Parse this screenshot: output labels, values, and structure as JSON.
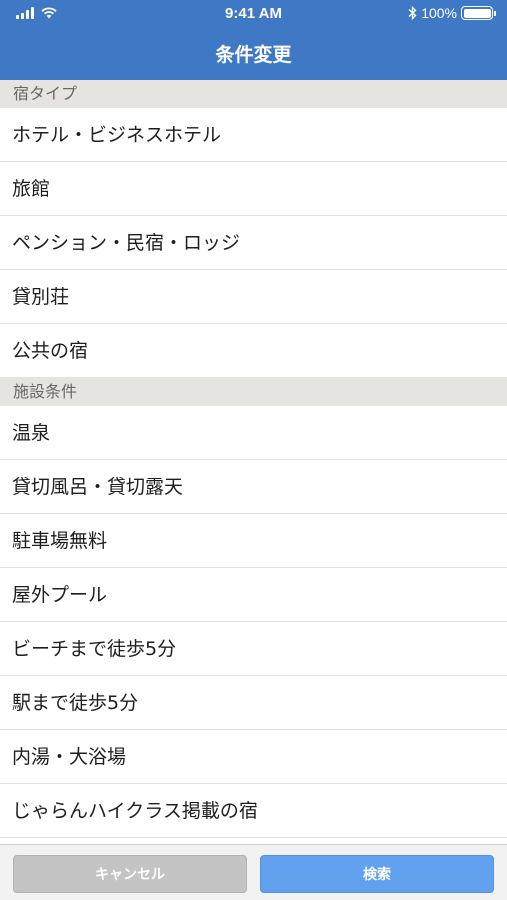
{
  "status_bar": {
    "time": "9:41 AM",
    "battery": "100%"
  },
  "nav": {
    "title": "条件変更"
  },
  "sections": [
    {
      "header": "宿タイプ",
      "items": [
        "ホテル・ビジネスホテル",
        "旅館",
        "ペンション・民宿・ロッジ",
        "貸別荘",
        "公共の宿"
      ]
    },
    {
      "header": "施設条件",
      "items": [
        "温泉",
        "貸切風呂・貸切露天",
        "駐車場無料",
        "屋外プール",
        "ビーチまで徒歩5分",
        "駅まで徒歩5分",
        "内湯・大浴場",
        "じゃらんハイクラス掲載の宿"
      ]
    }
  ],
  "toolbar": {
    "cancel_label": "キャンセル",
    "search_label": "検索"
  },
  "colors": {
    "nav": "#3f78c5",
    "section_bg": "#e6e3e0",
    "search_button": "#62a1ed",
    "cancel_button": "#c4c4c4"
  }
}
